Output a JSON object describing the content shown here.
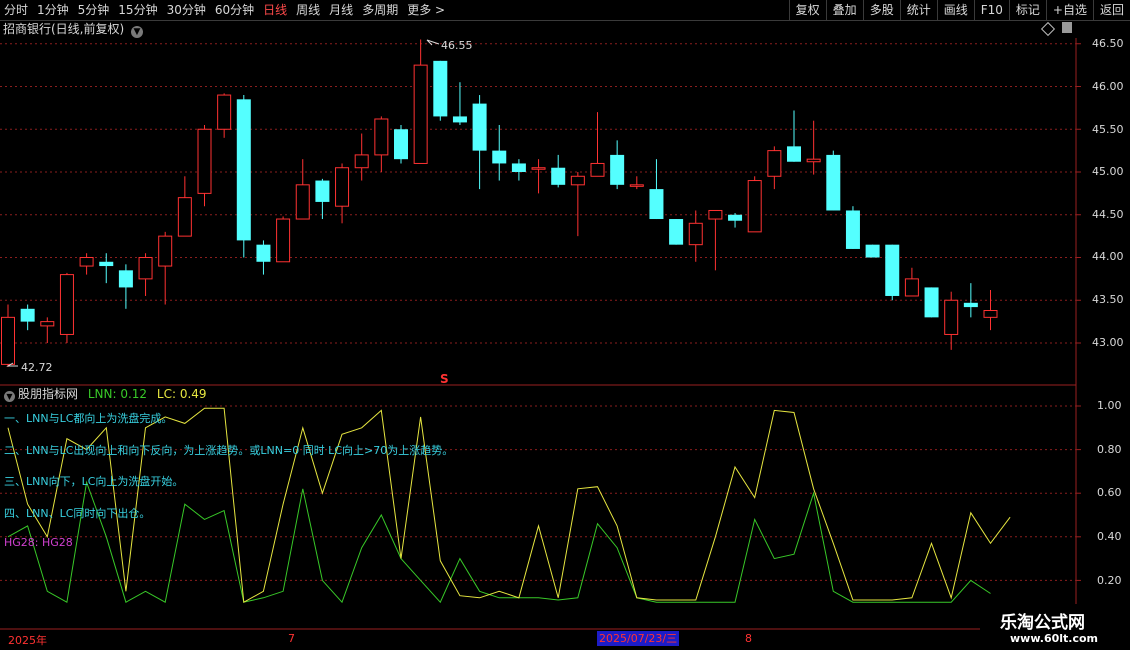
{
  "toolbar": {
    "periods": [
      {
        "label": "分时",
        "selected": false
      },
      {
        "label": "1分钟",
        "selected": false
      },
      {
        "label": "5分钟",
        "selected": false
      },
      {
        "label": "15分钟",
        "selected": false
      },
      {
        "label": "30分钟",
        "selected": false
      },
      {
        "label": "60分钟",
        "selected": false
      },
      {
        "label": "日线",
        "selected": true
      },
      {
        "label": "周线",
        "selected": false
      },
      {
        "label": "月线",
        "selected": false
      },
      {
        "label": "多周期",
        "selected": false
      },
      {
        "label": "更多 >",
        "selected": false
      }
    ],
    "right_buttons": [
      "复权",
      "叠加",
      "多股",
      "统计",
      "画线",
      "F10",
      "标记",
      "+自选",
      "返回"
    ]
  },
  "stock": {
    "title": "招商银行(日线,前复权)"
  },
  "price_axis": {
    "labels": [
      "46.50",
      "46.00",
      "45.50",
      "45.00",
      "44.50",
      "44.00",
      "43.50",
      "43.00"
    ]
  },
  "price_markers": {
    "high": "46.55",
    "low": "42.72",
    "s_marker": "S"
  },
  "indicator": {
    "name": "股朋指标网",
    "lnn_label": "LNN: 0.12",
    "lc_label": "LC: 0.49",
    "notes": [
      "一、LNN与LC都向上为洗盘完成。",
      "二、LNN与LC出现向上和向下反向，为上涨趋势。或LNN=0 同时 LC向上>70为上涨趋势。",
      "三、LNN向下，LC向上为洗盘开始。",
      "四、LNN、LC同时向下出仓。"
    ],
    "hg_label": "HG28: HG28",
    "axis_labels": [
      "1.00",
      "0.80",
      "0.60",
      "0.40",
      "0.20"
    ]
  },
  "timeline": {
    "year": "2025年",
    "m7": "7",
    "date_highlight": "2025/07/23/三",
    "m8": "8"
  },
  "watermark": {
    "title": "乐淘公式网",
    "url": "www.60lt.com"
  },
  "colors": {
    "up": "#ff3232",
    "down": "#54ffff",
    "lnn": "#38c828",
    "lc": "#e6e640",
    "grid": "#8a1e1e",
    "frame": "#9a2020"
  },
  "chart_data": [
    {
      "type": "candlestick",
      "title": "招商银行(日线,前复权)",
      "ylim": [
        42.5,
        46.75
      ],
      "y_ticks": [
        43.0,
        43.5,
        44.0,
        44.5,
        45.0,
        45.5,
        46.0,
        46.5
      ],
      "candles": [
        {
          "o": 42.75,
          "c": 43.3,
          "h": 43.45,
          "l": 42.72
        },
        {
          "o": 43.4,
          "c": 43.25,
          "h": 43.45,
          "l": 43.15
        },
        {
          "o": 43.2,
          "c": 43.25,
          "h": 43.3,
          "l": 43.0
        },
        {
          "o": 43.1,
          "c": 43.8,
          "h": 43.82,
          "l": 43.0
        },
        {
          "o": 43.9,
          "c": 44.0,
          "h": 44.05,
          "l": 43.8
        },
        {
          "o": 43.95,
          "c": 43.9,
          "h": 44.05,
          "l": 43.7
        },
        {
          "o": 43.85,
          "c": 43.65,
          "h": 43.92,
          "l": 43.4
        },
        {
          "o": 43.75,
          "c": 44.0,
          "h": 44.05,
          "l": 43.55
        },
        {
          "o": 43.9,
          "c": 44.25,
          "h": 44.3,
          "l": 43.45
        },
        {
          "o": 44.25,
          "c": 44.7,
          "h": 44.95,
          "l": 44.25
        },
        {
          "o": 44.75,
          "c": 45.5,
          "h": 45.55,
          "l": 44.6
        },
        {
          "o": 45.5,
          "c": 45.9,
          "h": 45.92,
          "l": 45.4
        },
        {
          "o": 45.85,
          "c": 44.2,
          "h": 45.9,
          "l": 44.0
        },
        {
          "o": 44.15,
          "c": 43.95,
          "h": 44.2,
          "l": 43.8
        },
        {
          "o": 43.95,
          "c": 44.45,
          "h": 44.48,
          "l": 43.95
        },
        {
          "o": 44.45,
          "c": 44.85,
          "h": 45.15,
          "l": 44.45
        },
        {
          "o": 44.9,
          "c": 44.65,
          "h": 44.92,
          "l": 44.45
        },
        {
          "o": 44.6,
          "c": 45.05,
          "h": 45.1,
          "l": 44.4
        },
        {
          "o": 45.05,
          "c": 45.2,
          "h": 45.45,
          "l": 44.9
        },
        {
          "o": 45.2,
          "c": 45.62,
          "h": 45.65,
          "l": 45.0
        },
        {
          "o": 45.5,
          "c": 45.15,
          "h": 45.55,
          "l": 45.1
        },
        {
          "o": 45.1,
          "c": 46.25,
          "h": 46.55,
          "l": 45.1
        },
        {
          "o": 46.3,
          "c": 45.65,
          "h": 46.3,
          "l": 45.6
        },
        {
          "o": 45.65,
          "c": 45.58,
          "h": 46.05,
          "l": 45.55
        },
        {
          "o": 45.8,
          "c": 45.25,
          "h": 45.9,
          "l": 44.8
        },
        {
          "o": 45.25,
          "c": 45.1,
          "h": 45.55,
          "l": 44.9
        },
        {
          "o": 45.1,
          "c": 45.0,
          "h": 45.15,
          "l": 44.9
        },
        {
          "o": 45.05,
          "c": 45.05,
          "h": 45.15,
          "l": 44.75
        },
        {
          "o": 45.05,
          "c": 44.85,
          "h": 45.2,
          "l": 44.82
        },
        {
          "o": 44.85,
          "c": 44.95,
          "h": 45.0,
          "l": 44.25
        },
        {
          "o": 44.95,
          "c": 45.1,
          "h": 45.7,
          "l": 44.95
        },
        {
          "o": 45.2,
          "c": 44.85,
          "h": 45.37,
          "l": 44.8
        },
        {
          "o": 44.85,
          "c": 44.85,
          "h": 44.95,
          "l": 44.8
        },
        {
          "o": 44.8,
          "c": 44.45,
          "h": 45.15,
          "l": 44.45
        },
        {
          "o": 44.45,
          "c": 44.15,
          "h": 44.45,
          "l": 44.15
        },
        {
          "o": 44.15,
          "c": 44.4,
          "h": 44.55,
          "l": 43.95
        },
        {
          "o": 44.45,
          "c": 44.55,
          "h": 44.55,
          "l": 43.85
        },
        {
          "o": 44.5,
          "c": 44.43,
          "h": 44.52,
          "l": 44.35
        },
        {
          "o": 44.3,
          "c": 44.9,
          "h": 44.95,
          "l": 44.3
        },
        {
          "o": 44.95,
          "c": 45.25,
          "h": 45.3,
          "l": 44.8
        },
        {
          "o": 45.3,
          "c": 45.12,
          "h": 45.72,
          "l": 45.12
        },
        {
          "o": 45.12,
          "c": 45.15,
          "h": 45.6,
          "l": 44.97
        },
        {
          "o": 45.2,
          "c": 44.55,
          "h": 45.25,
          "l": 44.55
        },
        {
          "o": 44.55,
          "c": 44.1,
          "h": 44.6,
          "l": 44.1
        },
        {
          "o": 44.15,
          "c": 44.0,
          "h": 44.15,
          "l": 44.0
        },
        {
          "o": 44.15,
          "c": 43.55,
          "h": 44.15,
          "l": 43.5
        },
        {
          "o": 43.55,
          "c": 43.75,
          "h": 43.88,
          "l": 43.55
        },
        {
          "o": 43.65,
          "c": 43.3,
          "h": 43.65,
          "l": 43.3
        },
        {
          "o": 43.1,
          "c": 43.5,
          "h": 43.6,
          "l": 42.92
        },
        {
          "o": 43.47,
          "c": 43.42,
          "h": 43.7,
          "l": 43.3
        },
        {
          "o": 43.3,
          "c": 43.38,
          "h": 43.62,
          "l": 43.15
        }
      ]
    },
    {
      "type": "line",
      "title": "股朋指标网",
      "ylim": [
        0.09,
        1.09
      ],
      "y_ticks": [
        0.2,
        0.4,
        0.6,
        0.8,
        1.0
      ],
      "series": [
        {
          "name": "LNN",
          "values": [
            0.4,
            0.45,
            0.15,
            0.1,
            0.65,
            0.4,
            0.1,
            0.15,
            0.1,
            0.55,
            0.48,
            0.52,
            0.1,
            0.12,
            0.15,
            0.62,
            0.2,
            0.1,
            0.35,
            0.5,
            0.3,
            0.2,
            0.1,
            0.3,
            0.15,
            0.12,
            0.12,
            0.12,
            0.11,
            0.12,
            0.46,
            0.35,
            0.12,
            0.1,
            0.1,
            0.1,
            0.1,
            0.1,
            0.48,
            0.3,
            0.32,
            0.6,
            0.15,
            0.1,
            0.1,
            0.1,
            0.1,
            0.1,
            0.1,
            0.2,
            0.14
          ]
        },
        {
          "name": "LC",
          "values": [
            0.9,
            0.55,
            0.4,
            0.85,
            0.8,
            0.9,
            0.15,
            0.9,
            0.95,
            0.92,
            0.99,
            0.99,
            0.1,
            0.15,
            0.55,
            0.9,
            0.6,
            0.87,
            0.9,
            0.98,
            0.3,
            0.95,
            0.29,
            0.13,
            0.12,
            0.15,
            0.12,
            0.45,
            0.12,
            0.62,
            0.63,
            0.45,
            0.12,
            0.11,
            0.11,
            0.11,
            0.4,
            0.72,
            0.58,
            0.98,
            0.97,
            0.62,
            0.37,
            0.11,
            0.11,
            0.11,
            0.12,
            0.37,
            0.12,
            0.51,
            0.37,
            0.49
          ]
        }
      ]
    }
  ]
}
